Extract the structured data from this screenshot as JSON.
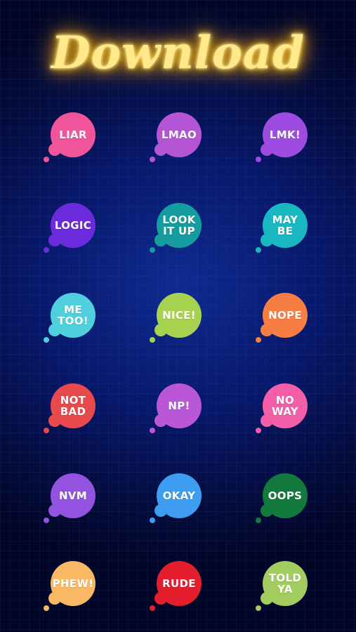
{
  "title": "Download",
  "stickers": [
    {
      "text": "LIAR",
      "color": "#f0559b",
      "icon": "speech-bubble-icon"
    },
    {
      "text": "LMAO",
      "color": "#b455d6",
      "icon": "speech-bubble-icon"
    },
    {
      "text": "LMK!",
      "color": "#9d4be0",
      "icon": "speech-bubble-icon"
    },
    {
      "text": "LOGIC",
      "color": "#6b2bdc",
      "icon": "speech-bubble-icon"
    },
    {
      "text": "LOOK\nIT UP",
      "color": "#149c9e",
      "icon": "speech-bubble-icon"
    },
    {
      "text": "MAY\nBE",
      "color": "#19b8c0",
      "icon": "speech-bubble-icon"
    },
    {
      "text": "ME\nTOO!",
      "color": "#4fd0dc",
      "icon": "speech-bubble-icon"
    },
    {
      "text": "NICE!",
      "color": "#a6d250",
      "icon": "speech-bubble-icon"
    },
    {
      "text": "NOPE",
      "color": "#f77e42",
      "icon": "speech-bubble-icon"
    },
    {
      "text": "NOT\nBAD",
      "color": "#e8494d",
      "icon": "speech-bubble-icon"
    },
    {
      "text": "NP!",
      "color": "#b957d8",
      "icon": "speech-bubble-icon"
    },
    {
      "text": "NO\nWAY",
      "color": "#f25ea8",
      "icon": "speech-bubble-icon"
    },
    {
      "text": "NVM",
      "color": "#9353e0",
      "icon": "speech-bubble-icon"
    },
    {
      "text": "OKAY",
      "color": "#3e9df0",
      "icon": "speech-bubble-icon"
    },
    {
      "text": "OOPS",
      "color": "#127a3c",
      "icon": "speech-bubble-icon"
    },
    {
      "text": "PHEW!",
      "color": "#f8b864",
      "icon": "speech-bubble-icon"
    },
    {
      "text": "RUDE",
      "color": "#e41e2c",
      "icon": "speech-bubble-icon"
    },
    {
      "text": "TOLD\nYA",
      "color": "#a3cc5e",
      "icon": "speech-bubble-icon"
    }
  ]
}
